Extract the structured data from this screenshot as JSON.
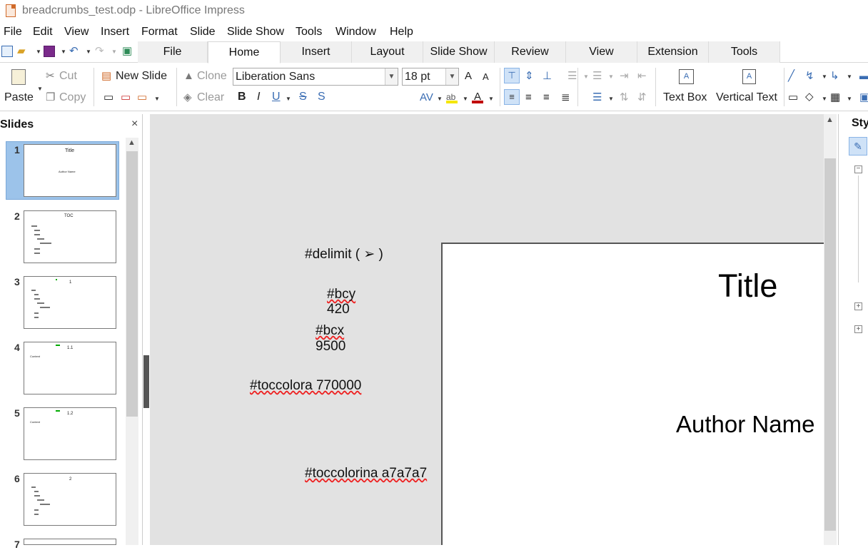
{
  "window": {
    "title": "breadcrumbs_test.odp - LibreOffice Impress"
  },
  "menu": [
    "File",
    "Edit",
    "View",
    "Insert",
    "Format",
    "Slide",
    "Slide Show",
    "Tools",
    "Window",
    "Help"
  ],
  "tabs": [
    "File",
    "Home",
    "Insert",
    "Layout",
    "Slide Show",
    "Review",
    "View",
    "Extension",
    "Tools"
  ],
  "ribbon": {
    "paste": "Paste",
    "cut": "Cut",
    "copy": "Copy",
    "new_slide": "New Slide",
    "clone": "Clone",
    "clear": "Clear",
    "font_name": "Liberation Sans",
    "font_size": "18 pt",
    "text_box": "Text Box",
    "vertical_text": "Vertical Text",
    "bold": "B",
    "italic": "I",
    "underline": "U",
    "strike": "S",
    "shadow": "S"
  },
  "slides_pane": {
    "header": "Slides",
    "thumbs": [
      {
        "num": "1",
        "title": "Title",
        "sub": "Author Name"
      },
      {
        "num": "2",
        "title": "TOC"
      },
      {
        "num": "3",
        "title": "1"
      },
      {
        "num": "4",
        "title": "1.1",
        "body": "Content"
      },
      {
        "num": "5",
        "title": "1.2",
        "body": "Content"
      },
      {
        "num": "6",
        "title": "2"
      },
      {
        "num": "7"
      }
    ]
  },
  "workspace": {
    "notes": {
      "delimit": "#delimit ( ➢ )",
      "bcy_label": "#bcy",
      "bcy_value": "420",
      "bcx_label": "#bcx",
      "bcx_value": "9500",
      "toccolora": "#toccolora 770000",
      "toccolorina": "#toccolorina a7a7a7"
    },
    "slide": {
      "title": "Title",
      "author": "Author Name"
    }
  },
  "right_pane": {
    "label": "Sty"
  },
  "colors": {
    "selection": "#9cc3ea",
    "workspace": "#e2e2e2",
    "icon_blue": "#3a6db3"
  }
}
